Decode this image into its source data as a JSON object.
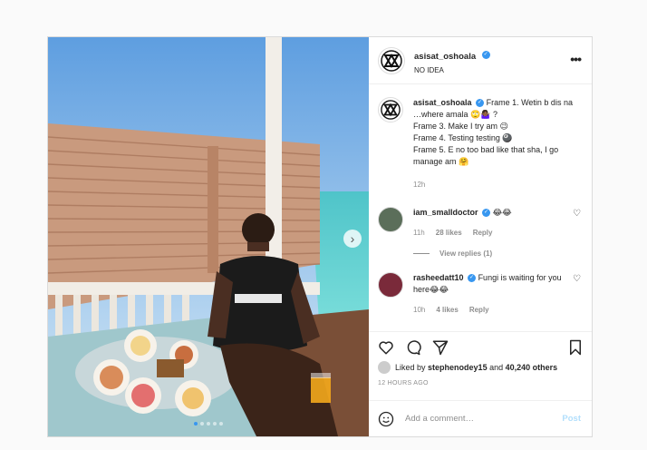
{
  "post": {
    "author": {
      "username": "asisat_oshoala",
      "location": "NO IDEA",
      "verified": true
    },
    "carousel": {
      "total": 5,
      "active": 1,
      "next_icon": "chevron-right-icon"
    },
    "caption": {
      "username": "asisat_oshoala",
      "line1": "Frame 1. Wetin b dis na …where amala 🙄🤷🏾‍♀️ ?",
      "line2": "Frame 3. Make I try am 😉",
      "line3": "Frame 4. Testing testing 🎱",
      "line4": "Frame 5. E no too bad like that sha, I go manage am 🤗",
      "time": "12h"
    },
    "comments": [
      {
        "username": "iam_smalldoctor",
        "text": "😂😂",
        "time": "11h",
        "likes": "28 likes",
        "reply": "Reply",
        "view_replies": "View replies (1)"
      },
      {
        "username": "rasheedatt10",
        "text": "Fungi is waiting for you here😂😂",
        "time": "10h",
        "likes": "4 likes",
        "reply": "Reply"
      }
    ],
    "liked_by": {
      "prefix": "Liked by",
      "user": "stephenodey15",
      "and": "and",
      "others": "40,240 others"
    },
    "timestamp": "12 HOURS AGO",
    "add_comment": {
      "placeholder": "Add a comment…",
      "post_label": "Post"
    },
    "colors": {
      "accent": "#3897f0",
      "post_disabled": "#b2dffc",
      "muted": "#8e8e8e"
    }
  }
}
